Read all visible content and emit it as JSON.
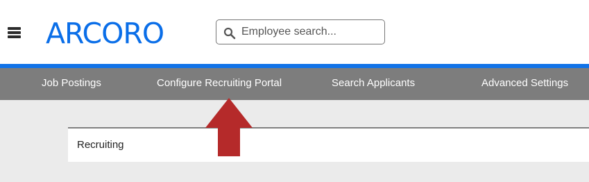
{
  "header": {
    "menu_icon": "hamburger-menu-icon",
    "logo_text": "ARCORO",
    "search": {
      "placeholder": "Employee search...",
      "value": "",
      "icon": "search-icon"
    }
  },
  "nav": {
    "items": [
      {
        "label": "Job Postings"
      },
      {
        "label": "Configure Recruiting Portal"
      },
      {
        "label": "Search Applicants"
      },
      {
        "label": "Advanced Settings"
      }
    ]
  },
  "content": {
    "card_title": "Recruiting"
  },
  "annotation": {
    "arrow": "up-arrow",
    "arrow_color": "#b52a2a"
  },
  "colors": {
    "brand_blue": "#0a6ee8",
    "nav_bg": "#7d7d7d",
    "content_bg": "#ebebeb"
  }
}
